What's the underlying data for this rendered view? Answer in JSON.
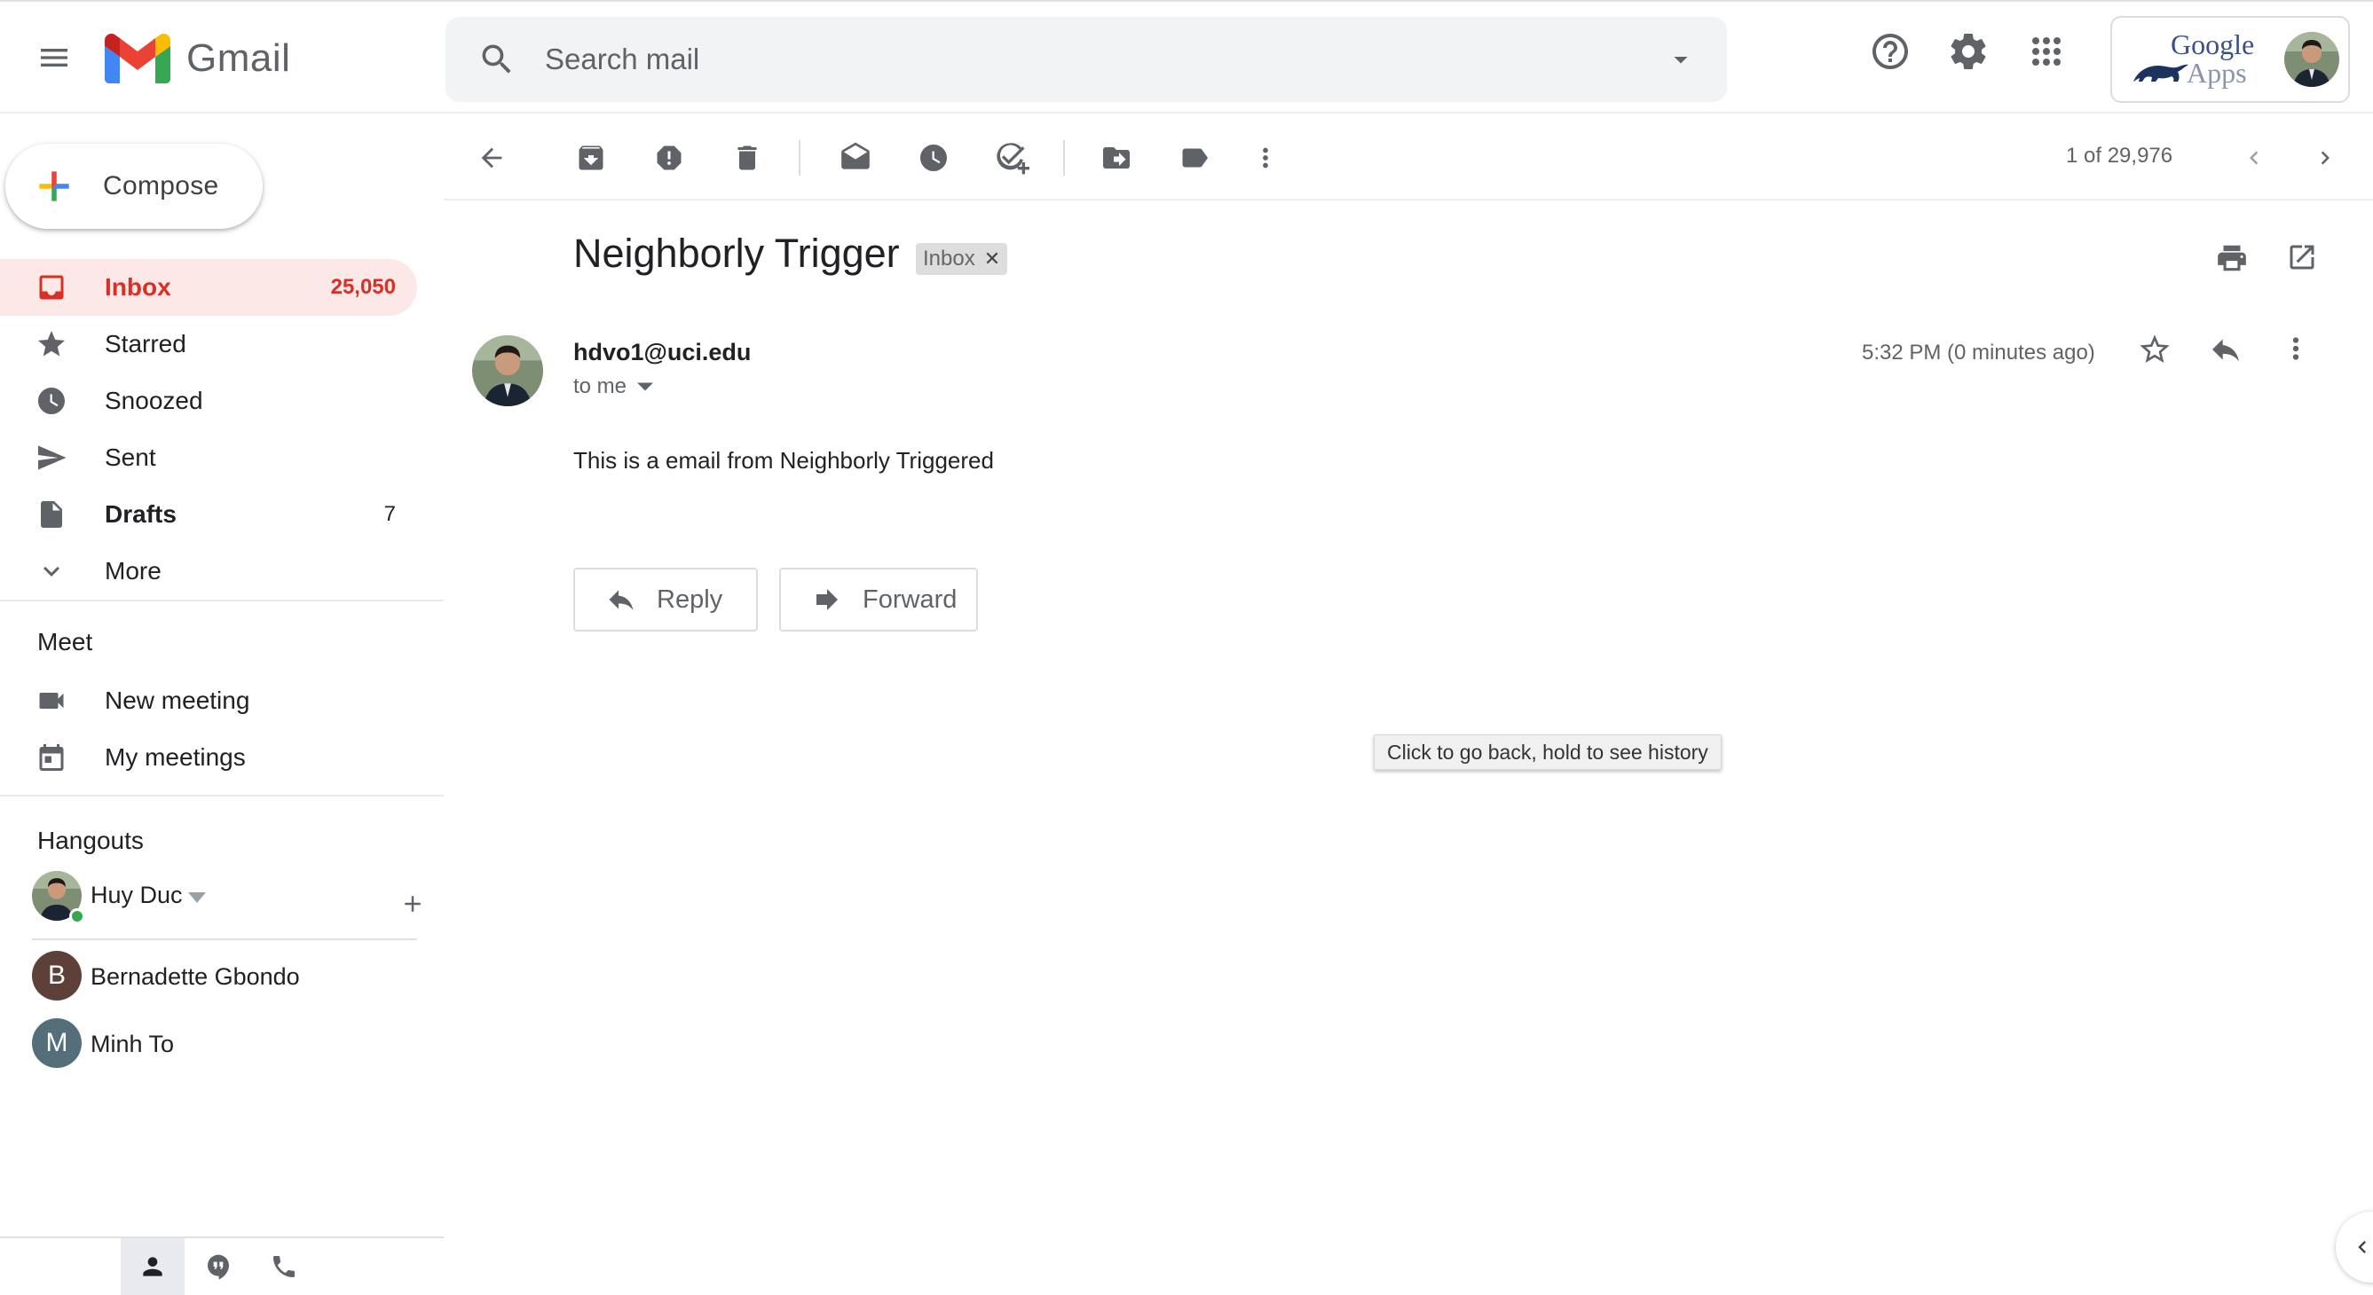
{
  "app": {
    "name": "Gmail"
  },
  "search": {
    "placeholder": "Search mail"
  },
  "account": {
    "brand_line1": "Google",
    "brand_line2": "Apps"
  },
  "compose": {
    "label": "Compose"
  },
  "nav": [
    {
      "label": "Inbox",
      "count": "25,050",
      "icon": "inbox-icon"
    },
    {
      "label": "Starred",
      "count": "",
      "icon": "star-icon"
    },
    {
      "label": "Snoozed",
      "count": "",
      "icon": "clock-icon"
    },
    {
      "label": "Sent",
      "count": "",
      "icon": "send-icon"
    },
    {
      "label": "Drafts",
      "count": "7",
      "icon": "draft-icon"
    },
    {
      "label": "More",
      "count": "",
      "icon": "chevron-down-icon"
    }
  ],
  "meet": {
    "title": "Meet",
    "items": [
      {
        "label": "New meeting",
        "icon": "video-camera-icon"
      },
      {
        "label": "My meetings",
        "icon": "calendar-icon"
      }
    ]
  },
  "hangouts": {
    "title": "Hangouts",
    "user": "Huy Duc",
    "contacts": [
      {
        "initial": "B",
        "name": "Bernadette Gbondo",
        "color": "#5d4037"
      },
      {
        "initial": "M",
        "name": "Minh To",
        "color": "#546e7a"
      }
    ]
  },
  "toolbar": {
    "pager": "1 of 29,976"
  },
  "message": {
    "subject": "Neighborly Trigger",
    "label": "Inbox",
    "sender": "hdvo1@uci.edu",
    "to": "to me",
    "time": "5:32 PM (0 minutes ago)",
    "body": "This is a email from Neighborly Triggered"
  },
  "actions": {
    "reply": "Reply",
    "forward": "Forward"
  },
  "tooltip": "Click to go back, hold to see history",
  "colors": {
    "accent_red": "#d93025",
    "active_bg": "#fce8e6",
    "icon_gray": "#5f6368"
  }
}
